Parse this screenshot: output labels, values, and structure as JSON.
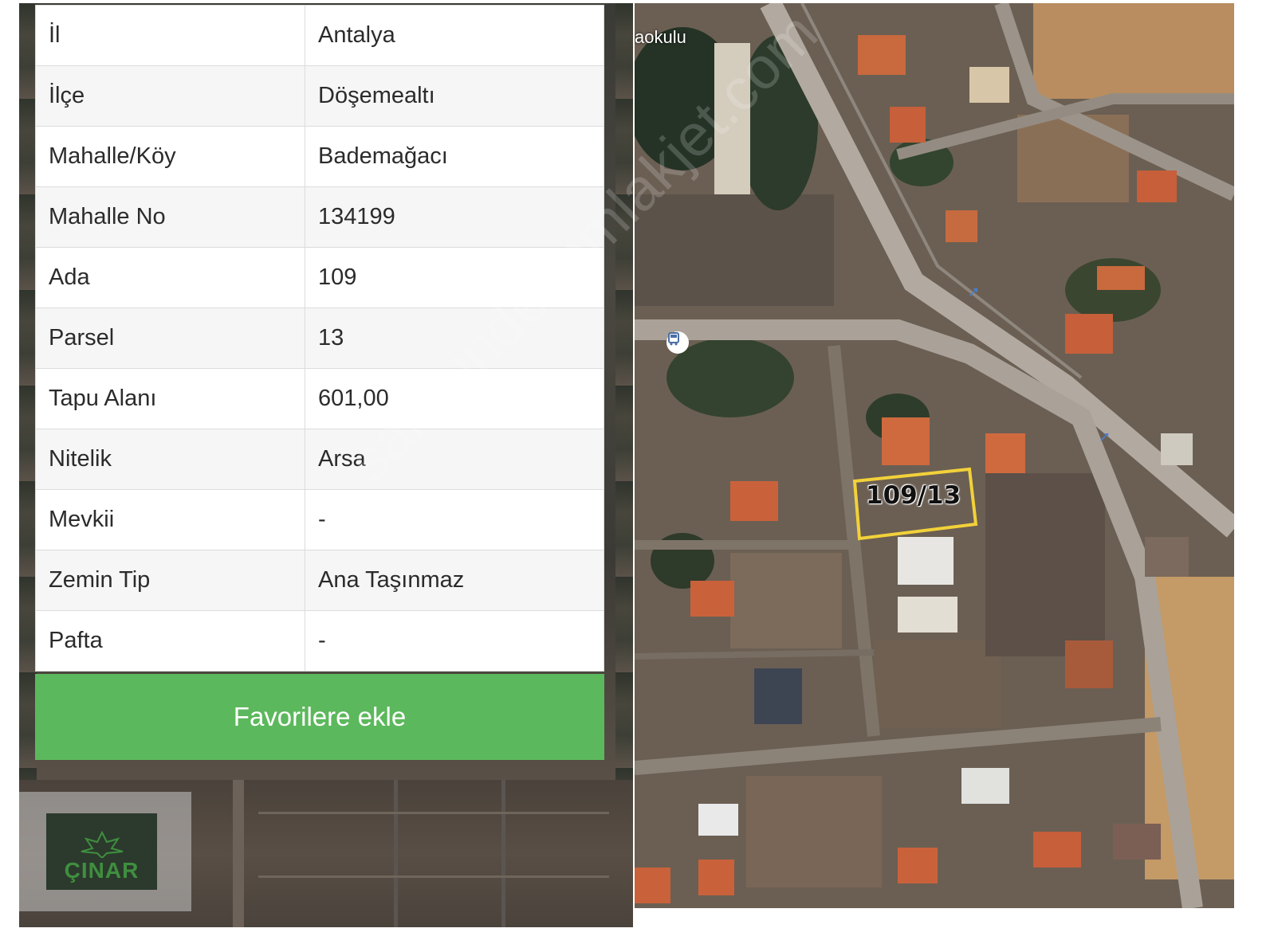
{
  "property_table": {
    "rows": [
      {
        "label": "İl",
        "value": "Antalya"
      },
      {
        "label": "İlçe",
        "value": "Döşemealtı"
      },
      {
        "label": "Mahalle/Köy",
        "value": "Bademağacı"
      },
      {
        "label": "Mahalle No",
        "value": "134199"
      },
      {
        "label": "Ada",
        "value": "109"
      },
      {
        "label": "Parsel",
        "value": "13"
      },
      {
        "label": "Tapu Alanı",
        "value": "601,00"
      },
      {
        "label": "Nitelik",
        "value": "Arsa"
      },
      {
        "label": "Mevkii",
        "value": "-"
      },
      {
        "label": "Zemin Tip",
        "value": "Ana Taşınmaz"
      },
      {
        "label": "Pafta",
        "value": "-"
      }
    ]
  },
  "favorite_button": {
    "label": "Favorilere ekle",
    "color": "#5cb85c"
  },
  "logo": {
    "text": "ÇINAR"
  },
  "map": {
    "school_label": "aokulu",
    "parcel_label": "109/13",
    "parcel_outline_color": "#f2d13a",
    "bus_stop_icon": "bus-stop-icon"
  },
  "watermark": {
    "text": "sahibindenemlakjet.com"
  }
}
